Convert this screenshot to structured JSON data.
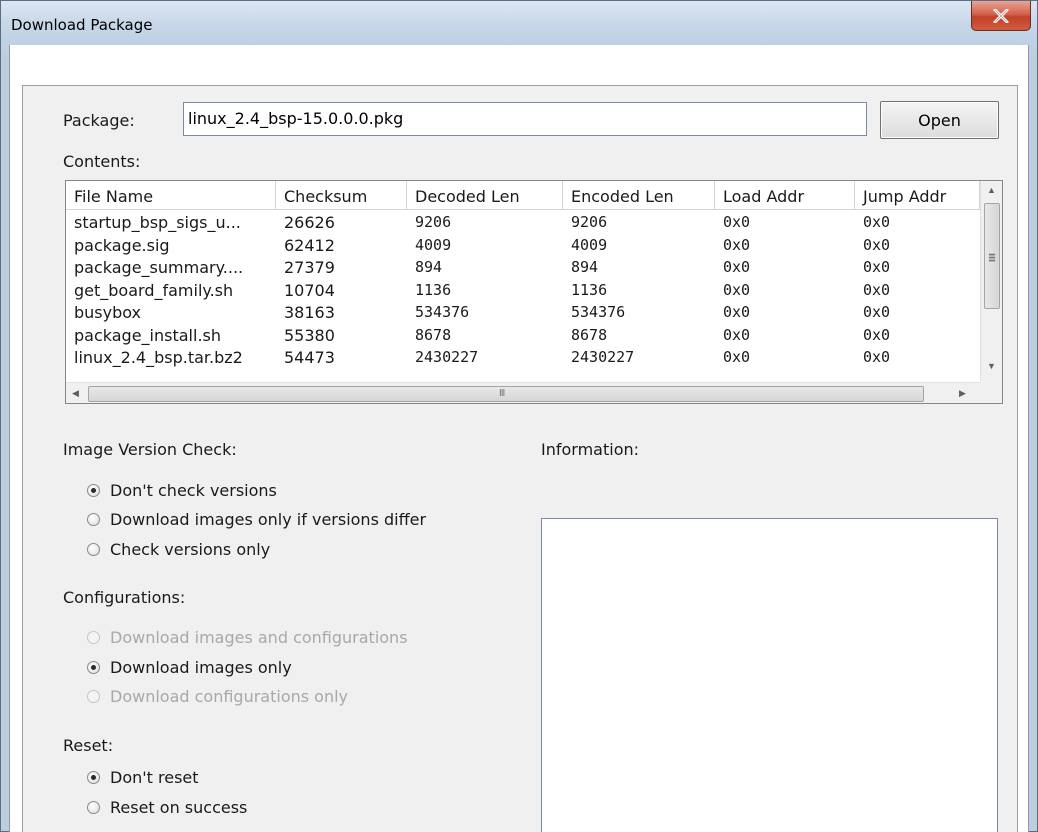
{
  "window": {
    "title": "Download Package"
  },
  "package": {
    "label": "Package:",
    "value": "linux_2.4_bsp-15.0.0.0.pkg",
    "open_label": "Open"
  },
  "contents": {
    "label": "Contents:",
    "columns": [
      "File Name",
      "Checksum",
      "Decoded Len",
      "Encoded Len",
      "Load Addr",
      "Jump Addr"
    ],
    "rows": [
      [
        "startup_bsp_sigs_u...",
        "26626",
        "9206",
        "9206",
        "0x0",
        "0x0"
      ],
      [
        "package.sig",
        "62412",
        "4009",
        "4009",
        "0x0",
        "0x0"
      ],
      [
        "package_summary....",
        "27379",
        "894",
        "894",
        "0x0",
        "0x0"
      ],
      [
        "get_board_family.sh",
        "10704",
        "1136",
        "1136",
        "0x0",
        "0x0"
      ],
      [
        "busybox",
        "38163",
        "534376",
        "534376",
        "0x0",
        "0x0"
      ],
      [
        "package_install.sh",
        "55380",
        "8678",
        "8678",
        "0x0",
        "0x0"
      ],
      [
        "linux_2.4_bsp.tar.bz2",
        "54473",
        "2430227",
        "2430227",
        "0x0",
        "0x0"
      ]
    ],
    "hscroll_grip": "III"
  },
  "image_version_check": {
    "label": "Image Version Check:",
    "options": [
      "Don't check versions",
      "Download images only if versions differ",
      "Check versions only"
    ],
    "selected": 0
  },
  "configurations": {
    "label": "Configurations:",
    "options": [
      "Download images and configurations",
      "Download images only",
      "Download configurations only"
    ],
    "selected": 1
  },
  "reset": {
    "label": "Reset:",
    "options": [
      "Don't reset",
      "Reset on success"
    ],
    "selected": 0
  },
  "information": {
    "label": "Information:"
  },
  "colors": {
    "close_button": "#c7432c",
    "panel": "#f0f0f0",
    "titlebar": "#c9d8e9"
  }
}
